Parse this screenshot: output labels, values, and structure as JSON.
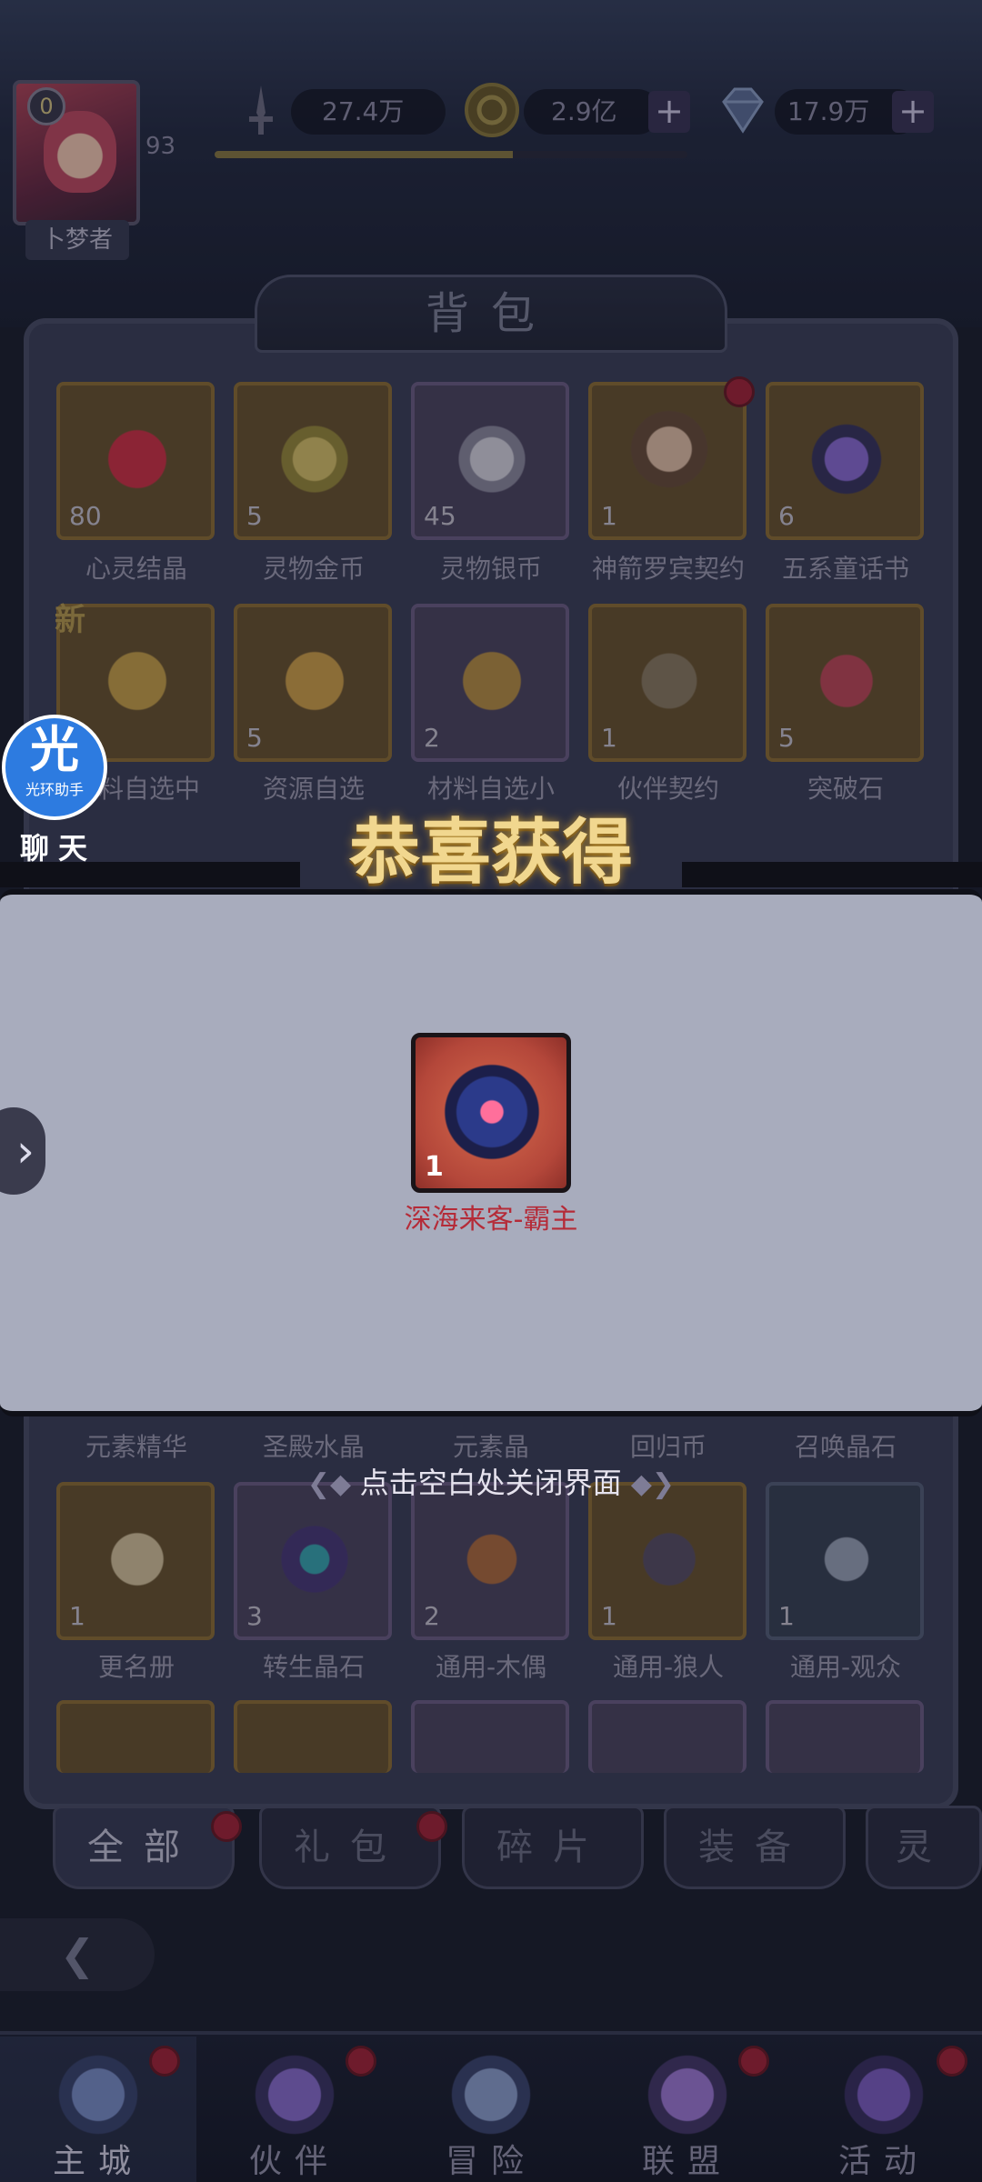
{
  "player": {
    "level_badge": "0",
    "level": "93",
    "name": "卜梦者"
  },
  "resources": [
    {
      "name": "power",
      "icon": "sword-icon",
      "value": "27.4万"
    },
    {
      "name": "gold",
      "icon": "gold-coin-icon",
      "value": "2.9亿"
    },
    {
      "name": "diamond",
      "icon": "diamond-icon",
      "value": "17.9万"
    }
  ],
  "exp_progress": 0.63,
  "bag": {
    "title": "背包",
    "row1": [
      {
        "label": "心灵结晶",
        "count": "80"
      },
      {
        "label": "灵物金币",
        "count": "5"
      },
      {
        "label": "灵物银币",
        "count": "45"
      },
      {
        "label": "神箭罗宾契约",
        "count": "1"
      },
      {
        "label": "五系童话书",
        "count": "6"
      }
    ],
    "row2": [
      {
        "label": "材料自选中",
        "count": ""
      },
      {
        "label": "资源自选",
        "count": "5"
      },
      {
        "label": "材料自选小",
        "count": "2"
      },
      {
        "label": "伙伴契约",
        "count": "1"
      },
      {
        "label": "突破石",
        "count": "5"
      }
    ],
    "row3_partial": [
      "元素精华",
      "圣殿水晶",
      "元素晶",
      "回归币",
      "召唤晶石"
    ],
    "row4": [
      {
        "label": "更名册",
        "count": "1"
      },
      {
        "label": "转生晶石",
        "count": "3"
      },
      {
        "label": "通用-木偶",
        "count": "2"
      },
      {
        "label": "通用-狼人",
        "count": "1"
      },
      {
        "label": "通用-观众",
        "count": "1"
      }
    ],
    "new_tag": "新"
  },
  "reward": {
    "title": "恭喜获得",
    "item_name": "深海来客-霸主",
    "item_count": "1",
    "close_hint": "点击空白处关闭界面"
  },
  "assistant": {
    "big": "光",
    "small": "光环助手",
    "chat": "聊天"
  },
  "tabs": [
    "全部",
    "礼包",
    "碎片",
    "装备",
    "灵"
  ],
  "bottom_nav": [
    "主城",
    "伙伴",
    "冒险",
    "联盟",
    "活动"
  ],
  "colors": {
    "reward_name": "#b52b38",
    "title_gold": "#f1d78f",
    "red_dot": "#a5243a"
  }
}
